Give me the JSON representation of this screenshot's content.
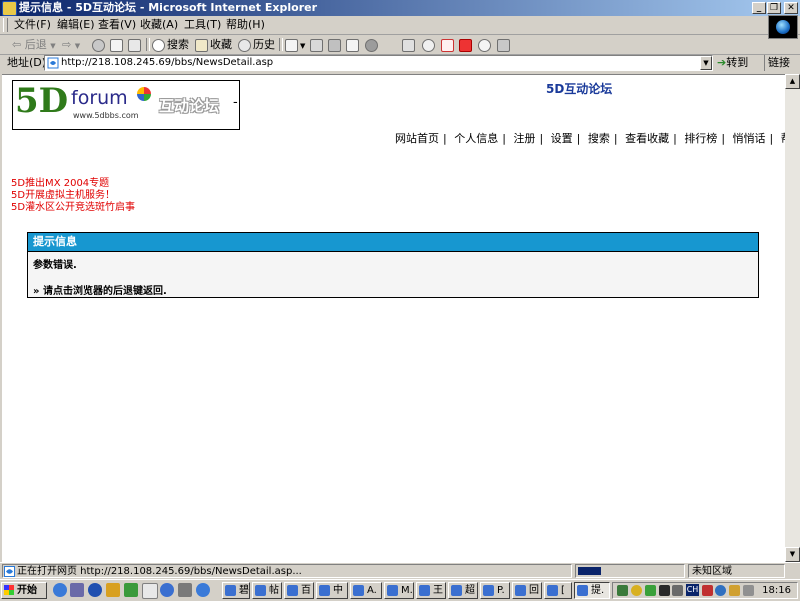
{
  "window": {
    "title": "提示信息 - 5D互动论坛 - Microsoft Internet Explorer",
    "minimize": "_",
    "restore": "❐",
    "close": "✕"
  },
  "menu": [
    "文件(F)",
    "编辑(E)",
    "查看(V)",
    "收藏(A)",
    "工具(T)",
    "帮助(H)"
  ],
  "toolbar": {
    "back": "后退",
    "search": "搜索",
    "favorites": "收藏",
    "history": "历史"
  },
  "address": {
    "label": "地址(D)",
    "url": "http://218.108.245.69/bbs/NewsDetail.asp",
    "go": "转到",
    "links": "链接"
  },
  "page": {
    "logo": {
      "five_d": "5D",
      "forum": "forum",
      "site": "www.5dbbs.com",
      "cn": "互动论坛",
      "dash": "-"
    },
    "forum_title": "5D互动论坛",
    "nav": [
      "网站首页",
      "个人信息",
      "注册",
      "设置",
      "搜索",
      "查看收藏",
      "排行榜",
      "悄悄话",
      "帮助"
    ],
    "announcements": [
      "5D推出MX 2004专题",
      "5D开展虚拟主机服务！",
      "5D灌水区公开竞选斑竹启事"
    ],
    "message": {
      "header": "提示信息",
      "line1": "参数错误.",
      "line2": "» 请点击浏览器的后退键返回."
    }
  },
  "status": {
    "text": "正在打开网页 http://218.108.245.69/bbs/NewsDetail.asp...",
    "progress": 0.22,
    "zone": "未知区域"
  },
  "taskbar": {
    "start": "开始",
    "tasks": [
      "碧",
      "帖",
      "百",
      "中",
      "A.",
      "M.",
      "王",
      "超",
      "P.",
      "回",
      "[",
      "提."
    ],
    "clock": "18:16"
  },
  "colors": {
    "title_gradient_start": "#0a246a",
    "title_gradient_end": "#a6caf0",
    "message_header": "#1797d0",
    "announcement": "#e00000",
    "forum_title": "#1a3a9a"
  }
}
